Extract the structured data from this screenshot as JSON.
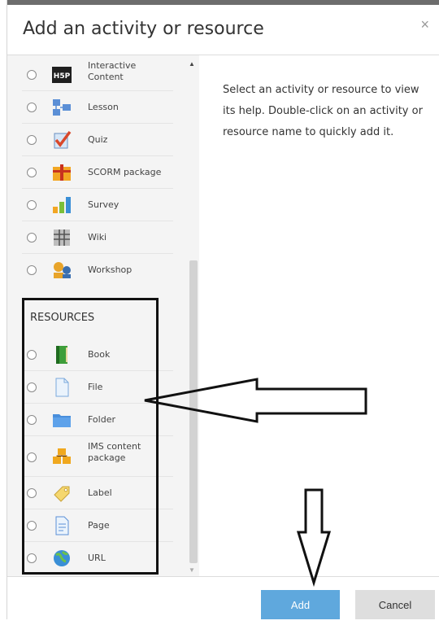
{
  "dialog": {
    "title": "Add an activity or resource",
    "close_symbol": "×",
    "help_text": "Select an activity or resource to view its help. Double-click on an activity or resource name to quickly add it."
  },
  "activities": [
    {
      "label": "Interactive Content",
      "icon": "h5p-icon"
    },
    {
      "label": "Lesson",
      "icon": "lesson-icon"
    },
    {
      "label": "Quiz",
      "icon": "quiz-icon"
    },
    {
      "label": "SCORM package",
      "icon": "scorm-icon"
    },
    {
      "label": "Survey",
      "icon": "survey-icon"
    },
    {
      "label": "Wiki",
      "icon": "wiki-icon"
    },
    {
      "label": "Workshop",
      "icon": "workshop-icon"
    }
  ],
  "resources_heading": "RESOURCES",
  "resources": [
    {
      "label": "Book",
      "icon": "book-icon"
    },
    {
      "label": "File",
      "icon": "file-icon"
    },
    {
      "label": "Folder",
      "icon": "folder-icon"
    },
    {
      "label": "IMS content package",
      "icon": "ims-package-icon"
    },
    {
      "label": "Label",
      "icon": "label-icon"
    },
    {
      "label": "Page",
      "icon": "page-icon"
    },
    {
      "label": "URL",
      "icon": "url-icon"
    }
  ],
  "footer": {
    "add_label": "Add",
    "cancel_label": "Cancel"
  },
  "colors": {
    "add_button": "#5fa8dd",
    "cancel_button": "#dedede",
    "annotation": "#111111"
  }
}
